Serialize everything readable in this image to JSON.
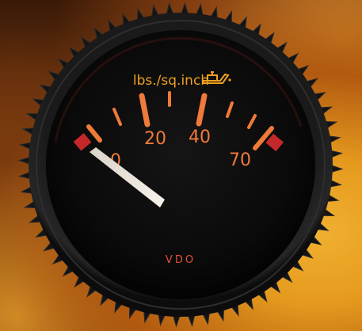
{
  "gauge": {
    "unit_label": "lbs./sq.inch",
    "icon": "oil-can-icon",
    "tick_labels": [
      "0",
      "20",
      "40",
      "70"
    ],
    "brand": "VDO",
    "needle_reading": 0,
    "colors": {
      "markings": "#f07a3a",
      "unit_label": "#f0a020",
      "danger_zone": "#c4282a",
      "needle": "#f2ede4"
    }
  }
}
